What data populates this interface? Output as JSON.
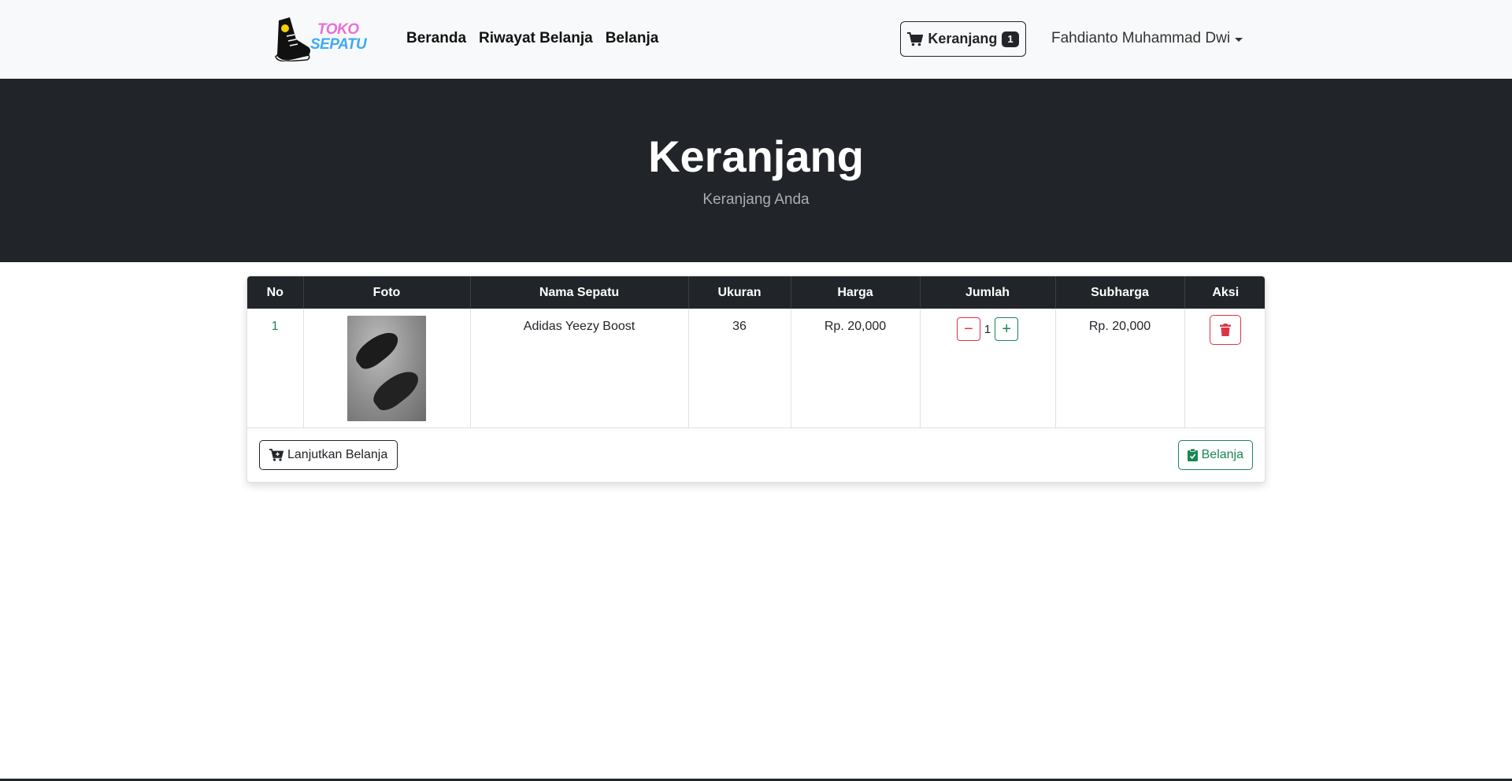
{
  "brand": {
    "line1": "TOKO",
    "line2": "SEPATU",
    "icon": "sneaker-logo-icon"
  },
  "nav": {
    "items": [
      {
        "label": "Beranda"
      },
      {
        "label": "Riwayat Belanja"
      },
      {
        "label": "Belanja"
      }
    ]
  },
  "cart": {
    "label": "Keranjang",
    "count": "1",
    "icon": "cart-icon"
  },
  "user": {
    "name": "Fahdianto Muhammad Dwi",
    "icon": "chevron-down-icon"
  },
  "hero": {
    "title": "Keranjang",
    "subtitle": "Keranjang Anda"
  },
  "table": {
    "headers": [
      "No",
      "Foto",
      "Nama Sepatu",
      "Ukuran",
      "Harga",
      "Jumlah",
      "Subharga",
      "Aksi"
    ],
    "rows": [
      {
        "no": "1",
        "photo_icon": "shoe-photo",
        "name": "Adidas Yeezy Boost",
        "size": "36",
        "price": "Rp. 20,000",
        "quantity": "1",
        "subtotal": "Rp. 20,000"
      }
    ]
  },
  "buttons": {
    "decrease_icon": "minus-icon",
    "increase_icon": "plus-icon",
    "delete_icon": "trash-icon",
    "continue": "Lanjutkan Belanja",
    "checkout": "Belanja"
  },
  "colors": {
    "dark": "#212529",
    "danger": "#dc3545",
    "success": "#198754",
    "navbar": "#f8f9fa",
    "brand_pink": "#ea6fd6",
    "brand_blue": "#3fa9f5"
  }
}
